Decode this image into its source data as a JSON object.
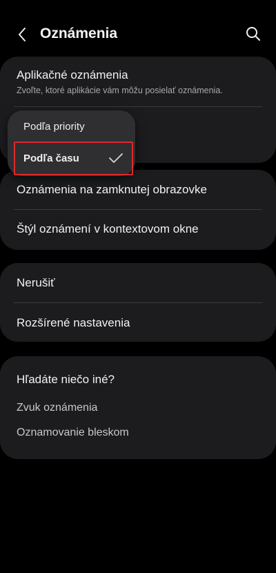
{
  "header": {
    "title": "Oznámenia",
    "back_icon": "chevron-left-icon",
    "search_icon": "search-icon"
  },
  "card1": {
    "app_notifications": {
      "label": "Aplikačné oznámenia",
      "sublabel": "Zvoľte, ktoré aplikácie vám môžu posielať oznámenia."
    }
  },
  "popup": {
    "options": [
      {
        "label": "Podľa priority",
        "selected": false
      },
      {
        "label": "Podľa času",
        "selected": true
      }
    ]
  },
  "card2": {
    "items": [
      {
        "label": "Oznámenia na zamknutej obrazovke"
      },
      {
        "label": "Štýl oznámení v kontextovom okne"
      }
    ]
  },
  "card3": {
    "items": [
      {
        "label": "Nerušiť"
      },
      {
        "label": "Rozšírené nastavenia"
      }
    ]
  },
  "card4": {
    "title": "Hľadáte niečo iné?",
    "links": [
      {
        "label": "Zvuk oznámenia"
      },
      {
        "label": "Oznamovanie bleskom"
      }
    ]
  },
  "colors": {
    "background": "#000000",
    "card": "#1c1c1e",
    "popup": "#2f2f31",
    "highlight": "#e0282e"
  }
}
